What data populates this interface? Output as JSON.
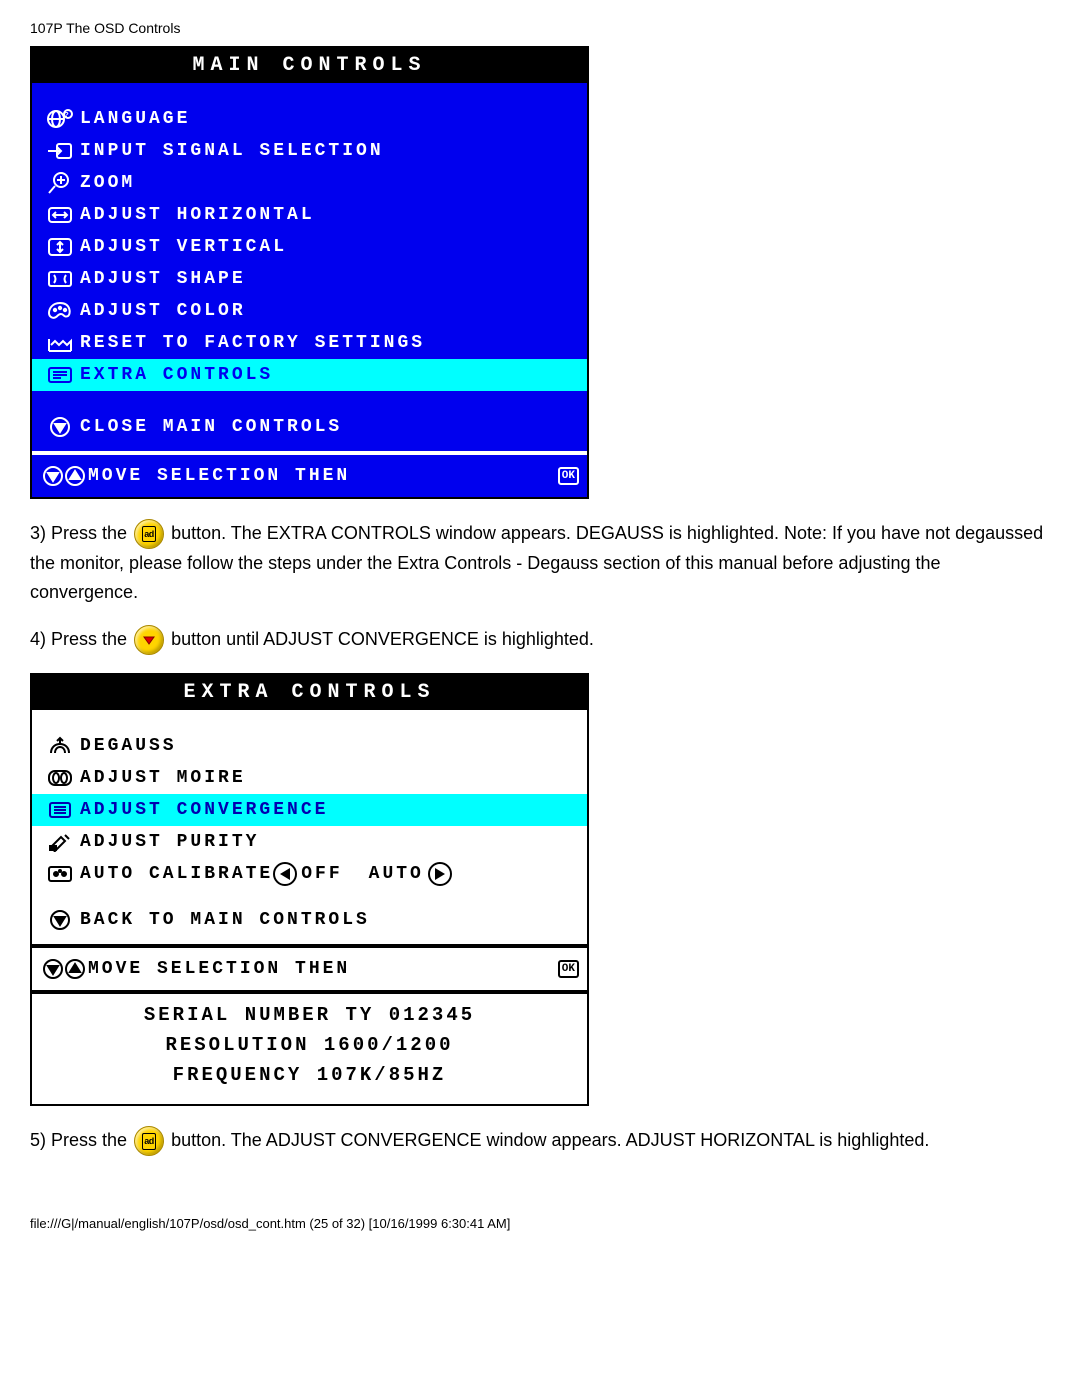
{
  "doc_header": "107P The OSD Controls",
  "main_osd": {
    "title": "MAIN CONTROLS",
    "items": [
      {
        "label": "LANGUAGE",
        "icon": "globe"
      },
      {
        "label": "INPUT SIGNAL SELECTION",
        "icon": "input"
      },
      {
        "label": "ZOOM",
        "icon": "zoom"
      },
      {
        "label": "ADJUST HORIZONTAL",
        "icon": "horiz"
      },
      {
        "label": "ADJUST VERTICAL",
        "icon": "vert"
      },
      {
        "label": "ADJUST SHAPE",
        "icon": "shape"
      },
      {
        "label": "ADJUST COLOR",
        "icon": "palette"
      },
      {
        "label": "RESET TO FACTORY SETTINGS",
        "icon": "factory"
      },
      {
        "label": "EXTRA CONTROLS",
        "icon": "list",
        "highlight": true
      }
    ],
    "close": "CLOSE MAIN CONTROLS",
    "footer": "MOVE SELECTION THEN"
  },
  "step3_a": "3) Press the ",
  "step3_b": " button. The EXTRA CONTROLS window appears. DEGAUSS is highlighted. Note: If you have not degaussed the monitor, please follow the steps under the Extra Controls - Degauss section of this manual before adjusting the convergence.",
  "step4_a": "4) Press the ",
  "step4_b": " button until ADJUST CONVERGENCE is highlighted.",
  "extra_osd": {
    "title": "EXTRA CONTROLS",
    "items": [
      {
        "label": "DEGAUSS",
        "icon": "degauss"
      },
      {
        "label": "ADJUST MOIRE",
        "icon": "moire"
      },
      {
        "label": "ADJUST CONVERGENCE",
        "icon": "converge",
        "highlight": true
      },
      {
        "label": "ADJUST PURITY",
        "icon": "purity"
      },
      {
        "label": "AUTO CALIBRATE",
        "icon": "calibrate",
        "extra_off": "OFF",
        "extra_auto": "AUTO"
      }
    ],
    "back": "BACK TO MAIN CONTROLS",
    "footer": "MOVE SELECTION THEN",
    "serial": "SERIAL NUMBER TY 012345",
    "resolution": "RESOLUTION 1600/1200",
    "frequency": "FREQUENCY 107K/85HZ"
  },
  "step5_a": "5) Press the ",
  "step5_b": " button. The ADJUST CONVERGENCE window appears. ADJUST HORIZONTAL is highlighted.",
  "page_footer": "file:///G|/manual/english/107P/osd/osd_cont.htm (25 of 32) [10/16/1999 6:30:41 AM]"
}
